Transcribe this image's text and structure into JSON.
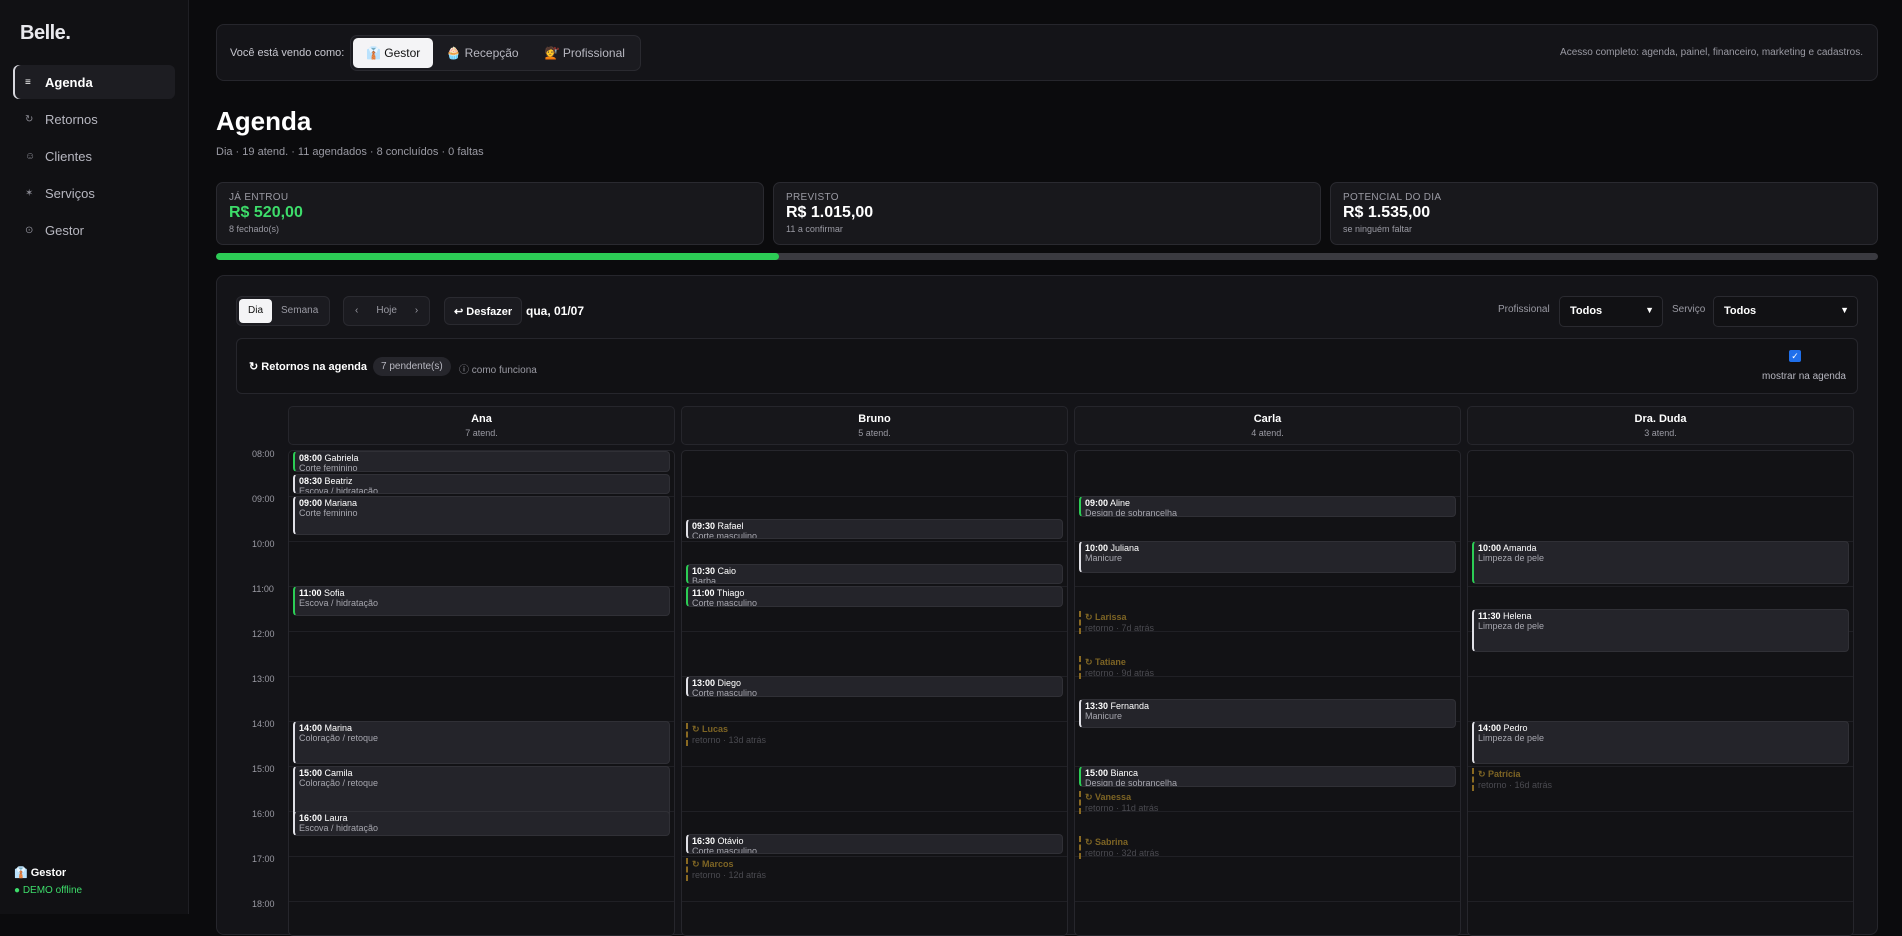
{
  "app": {
    "logo": "Belle",
    "logo_dot": "."
  },
  "sidebar": {
    "items": [
      {
        "icon": "≡",
        "label": "Agenda"
      },
      {
        "icon": "↻",
        "label": "Retornos"
      },
      {
        "icon": "☺",
        "label": "Clientes"
      },
      {
        "icon": "✶",
        "label": "Serviços"
      },
      {
        "icon": "⊙",
        "label": "Gestor"
      }
    ],
    "footer": {
      "role": "👔 Gestor",
      "status": "● DEMO offline"
    }
  },
  "rolebar": {
    "label": "Você está vendo como:",
    "roles": [
      "👔 Gestor",
      "🧁 Recepção",
      "💇 Profissional"
    ],
    "description": "Acesso completo: agenda, painel, financeiro, marketing e cadastros."
  },
  "page": {
    "title": "Agenda",
    "subtitle": "Dia · 19 atend. · 11 agendados · 8 concluídos · 0 faltas"
  },
  "kpis": [
    {
      "label": "JÁ ENTROU",
      "value": "R$ 520,00",
      "note": "8 fechado(s)"
    },
    {
      "label": "PREVISTO",
      "value": "R$ 1.015,00",
      "note": "11 a confirmar"
    },
    {
      "label": "POTENCIAL DO DIA",
      "value": "R$ 1.535,00",
      "note": "se ninguém faltar"
    }
  ],
  "progress": {
    "fraction": 0.339,
    "color": "#2ccc55"
  },
  "toolbar": {
    "views": [
      "Dia",
      "Semana"
    ],
    "prev": "‹",
    "today": "Hoje",
    "next": "›",
    "undo": "↩ Desfazer",
    "date": "qua, 01/07",
    "professional_label": "Profissional",
    "professional_value": "Todos",
    "service_label": "Serviço",
    "service_value": "Todos"
  },
  "returns_box": {
    "title": "↻ Retornos na agenda",
    "badge": "7 pendente(s)",
    "how": "ⓘ como funciona",
    "check": "✓",
    "check_label": "mostrar na agenda"
  },
  "hours": [
    "08:00",
    "09:00",
    "10:00",
    "11:00",
    "12:00",
    "13:00",
    "14:00",
    "15:00",
    "16:00",
    "17:00",
    "18:00"
  ],
  "columns": [
    {
      "name": "Ana",
      "count": "7 atend.",
      "appointments": [
        {
          "time": "08:00",
          "client": "Gabriela",
          "service": "Corte feminino",
          "done": true,
          "start": 8.0,
          "end": 8.5
        },
        {
          "time": "08:30",
          "client": "Beatriz",
          "service": "Escova / hidratação",
          "done": false,
          "start": 8.5,
          "end": 9.0
        },
        {
          "time": "09:00",
          "client": "Mariana",
          "service": "Corte feminino",
          "done": false,
          "start": 9.0,
          "end": 9.9
        },
        {
          "time": "11:00",
          "client": "Sofia",
          "service": "Escova / hidratação",
          "done": true,
          "start": 11.0,
          "end": 11.7
        },
        {
          "time": "14:00",
          "client": "Marina",
          "service": "Coloração / retoque",
          "done": false,
          "start": 14.0,
          "end": 15.0
        },
        {
          "time": "15:00",
          "client": "Camila",
          "service": "Coloração / retoque",
          "done": false,
          "start": 15.0,
          "end": 16.4
        },
        {
          "time": "16:00",
          "client": "Laura",
          "service": "Escova / hidratação",
          "done": false,
          "start": 16.0,
          "end": 16.6
        }
      ],
      "returns": []
    },
    {
      "name": "Bruno",
      "count": "5 atend.",
      "appointments": [
        {
          "time": "09:30",
          "client": "Rafael",
          "service": "Corte masculino",
          "done": false,
          "start": 9.5,
          "end": 10.0
        },
        {
          "time": "10:30",
          "client": "Caio",
          "service": "Barba",
          "done": true,
          "start": 10.5,
          "end": 11.0
        },
        {
          "time": "11:00",
          "client": "Thiago",
          "service": "Corte masculino",
          "done": true,
          "start": 11.0,
          "end": 11.5
        },
        {
          "time": "13:00",
          "client": "Diego",
          "service": "Corte masculino",
          "done": false,
          "start": 13.0,
          "end": 13.5
        },
        {
          "time": "16:30",
          "client": "Otávio",
          "service": "Corte masculino",
          "done": false,
          "start": 16.5,
          "end": 17.0
        }
      ],
      "returns": [
        {
          "name": "↻ Lucas",
          "note": "retorno · 13d atrás",
          "start": 14.0
        },
        {
          "name": "↻ Marcos",
          "note": "retorno · 12d atrás",
          "start": 17.0
        }
      ]
    },
    {
      "name": "Carla",
      "count": "4 atend.",
      "appointments": [
        {
          "time": "09:00",
          "client": "Aline",
          "service": "Design de sobrancelha",
          "done": true,
          "start": 9.0,
          "end": 9.5
        },
        {
          "time": "10:00",
          "client": "Juliana",
          "service": "Manicure",
          "done": false,
          "start": 10.0,
          "end": 10.75
        },
        {
          "time": "13:30",
          "client": "Fernanda",
          "service": "Manicure",
          "done": false,
          "start": 13.5,
          "end": 14.2
        },
        {
          "time": "15:00",
          "client": "Bianca",
          "service": "Design de sobrancelha",
          "done": true,
          "start": 15.0,
          "end": 15.5
        }
      ],
      "returns": [
        {
          "name": "↻ Larissa",
          "note": "retorno · 7d atrás",
          "start": 11.5
        },
        {
          "name": "↻ Tatiane",
          "note": "retorno · 9d atrás",
          "start": 12.5
        },
        {
          "name": "↻ Vanessa",
          "note": "retorno · 11d atrás",
          "start": 15.5
        },
        {
          "name": "↻ Sabrina",
          "note": "retorno · 32d atrás",
          "start": 16.5
        }
      ]
    },
    {
      "name": "Dra. Duda",
      "count": "3 atend.",
      "appointments": [
        {
          "time": "10:00",
          "client": "Amanda",
          "service": "Limpeza de pele",
          "done": true,
          "start": 10.0,
          "end": 11.0
        },
        {
          "time": "11:30",
          "client": "Helena",
          "service": "Limpeza de pele",
          "done": false,
          "start": 11.5,
          "end": 12.5
        },
        {
          "time": "14:00",
          "client": "Pedro",
          "service": "Limpeza de pele",
          "done": false,
          "start": 14.0,
          "end": 15.0
        }
      ],
      "returns": [
        {
          "name": "↻ Patrícia",
          "note": "retorno · 16d atrás",
          "start": 15.0
        }
      ]
    }
  ]
}
